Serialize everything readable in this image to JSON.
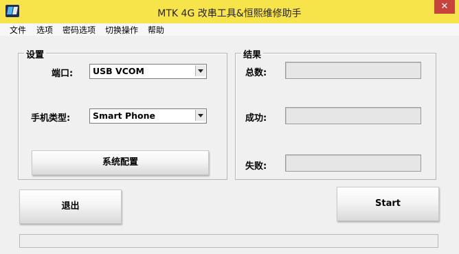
{
  "window": {
    "title": "MTK 4G 改串工具&恒熙维修助手",
    "close_glyph": "✕"
  },
  "menu": [
    "文件",
    "选项",
    "密码选项",
    "切换操作",
    "帮助"
  ],
  "settings": {
    "legend": "设置",
    "port_label": "端口:",
    "port_value": "USB VCOM",
    "phone_type_label": "手机类型:",
    "phone_type_value": "Smart Phone",
    "config_button": "系统配置"
  },
  "results": {
    "legend": "结果",
    "total_label": "总数:",
    "total_value": "",
    "success_label": "成功:",
    "success_value": "",
    "fail_label": "失败:",
    "fail_value": ""
  },
  "buttons": {
    "exit": "退出",
    "start": "Start"
  },
  "status": {
    "text": ""
  }
}
